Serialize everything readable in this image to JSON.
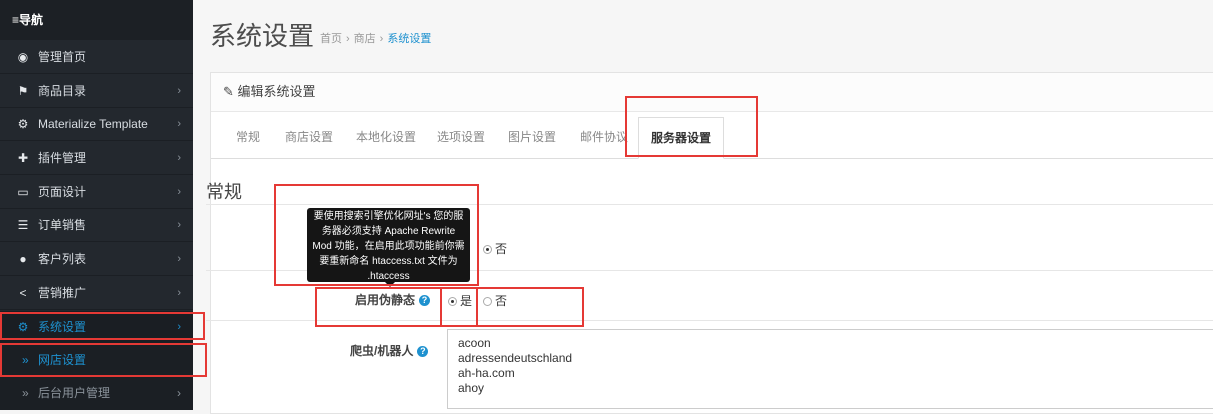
{
  "nav": {
    "header": "≡导航",
    "items": [
      {
        "label": "管理首页",
        "icon": "dashboard-icon",
        "glyph": "◉",
        "chevron": ""
      },
      {
        "label": "商品目录",
        "icon": "tags-icon",
        "glyph": "🏷",
        "chevron": "›"
      },
      {
        "label": "Materialize Template",
        "icon": "cogs-icon",
        "glyph": "⚙",
        "chevron": "›"
      },
      {
        "label": "插件管理",
        "icon": "puzzle-icon",
        "glyph": "✚",
        "chevron": "›"
      },
      {
        "label": "页面设计",
        "icon": "monitor-icon",
        "glyph": "▭",
        "chevron": "›"
      },
      {
        "label": "订单销售",
        "icon": "cart-icon",
        "glyph": "🛒",
        "chevron": "›"
      },
      {
        "label": "客户列表",
        "icon": "user-icon",
        "glyph": "👤",
        "chevron": "›"
      },
      {
        "label": "营销推广",
        "icon": "share-icon",
        "glyph": "<",
        "chevron": "›"
      },
      {
        "label": "系统设置",
        "icon": "gear-icon",
        "glyph": "⚙",
        "chevron": "›"
      }
    ],
    "subitems": [
      {
        "label": "网店设置",
        "prefix": "»"
      },
      {
        "label": "后台用户管理",
        "prefix": "»",
        "chevron": "›"
      }
    ]
  },
  "page": {
    "title": "系统设置",
    "breadcrumb": [
      "首页",
      "商店",
      "系统设置"
    ]
  },
  "panel": {
    "icon": "pencil-icon",
    "title": "✎ 编辑系统设置",
    "tabs": [
      "常规",
      "商店设置",
      "本地化设置",
      "选项设置",
      "图片设置",
      "邮件协议",
      "服务器设置"
    ],
    "active_tab": "服务器设置",
    "section_title": "常规"
  },
  "form": {
    "row1": {
      "no_label": "否",
      "selected": "no"
    },
    "seo_url": {
      "label": "启用伪静态",
      "yes_label": "是",
      "no_label": "否",
      "selected": "yes"
    },
    "robots": {
      "label": "爬虫/机器人",
      "lines": [
        "acoon",
        "adressendeutschland",
        "ah-ha.com",
        "ahoy"
      ]
    }
  },
  "tooltip": {
    "text": "要使用搜索引擎优化网址's 您的服务器必须支持 Apache Rewrite Mod 功能，在启用此项功能前你需要重新命名 htaccess.txt 文件为 .htaccess"
  },
  "colors": {
    "accent": "#1e91cf",
    "annotation": "#e53935",
    "sidebar": "#23282e"
  }
}
